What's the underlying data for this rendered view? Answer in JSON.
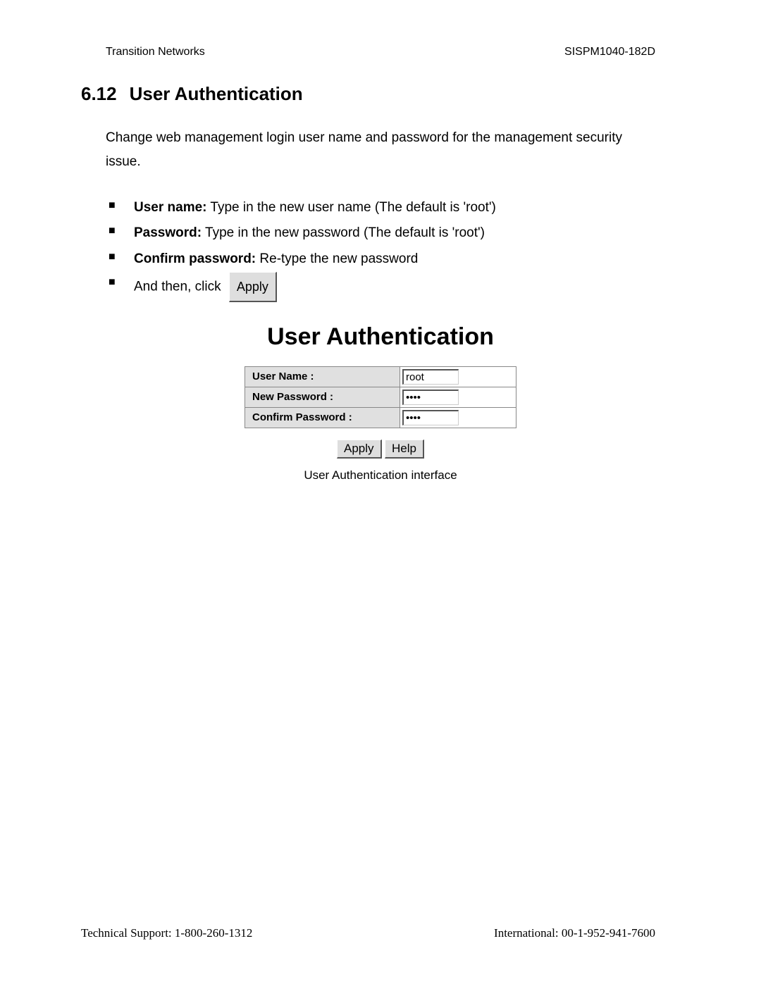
{
  "header": {
    "left": "Transition Networks",
    "right": "SISPM1040-182D"
  },
  "section": {
    "number": "6.12",
    "title": "User Authentication"
  },
  "intro": "Change web management login user name and password for the management security issue.",
  "bullets": {
    "b1_label": "User name:",
    "b1_text": " Type in the new user name (The default is 'root')",
    "b2_label": "Password:",
    "b2_text": " Type in the new password (The default is 'root')",
    "b3_label": "Confirm password:",
    "b3_text": " Re-type the new password",
    "b4_text": "And then, click ",
    "b4_button": "Apply"
  },
  "ui": {
    "title": "User Authentication",
    "rows": {
      "username_label": "User Name :",
      "username_value": "root",
      "newpass_label": "New Password :",
      "newpass_value": "••••",
      "confirm_label": "Confirm Password :",
      "confirm_value": "••••"
    },
    "buttons": {
      "apply": "Apply",
      "help": "Help"
    },
    "caption": "User Authentication interface"
  },
  "footer": {
    "left": "Technical Support: 1-800-260-1312",
    "right": "International: 00-1-952-941-7600"
  }
}
